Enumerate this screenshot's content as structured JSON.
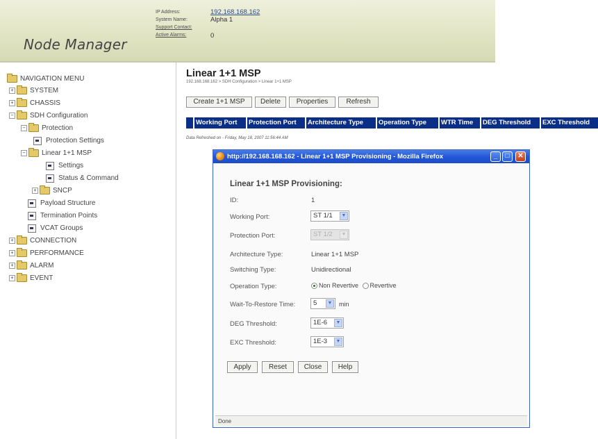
{
  "header": {
    "app_title": "Node Manager",
    "labels": {
      "ip_address": "IP Address:",
      "system_name": "System Name:",
      "support_contact": "Support Contact:",
      "active_alarms": "Active Alarms:"
    },
    "values": {
      "ip_address": "192.168.168.162",
      "system_name": "Alpha 1",
      "active_alarms": "0"
    }
  },
  "nav": {
    "title": "NAVIGATION MENU",
    "system": "SYSTEM",
    "chassis": "CHASSIS",
    "sdh_configuration": "SDH Configuration",
    "protection": "Protection",
    "protection_settings": "Protection Settings",
    "linear_msp": "Linear 1+1 MSP",
    "settings": "Settings",
    "status_command": "Status & Command",
    "sncp": "SNCP",
    "payload_structure": "Payload Structure",
    "termination_points": "Termination Points",
    "vcat_groups": "VCAT Groups",
    "connection": "CONNECTION",
    "performance": "PERFORMANCE",
    "alarm": "ALARM",
    "event": "EVENT"
  },
  "main": {
    "title": "Linear 1+1 MSP",
    "breadcrumb": "192.168.168.162 > SDH Configuration > Linear 1+1 MSP",
    "buttons": {
      "create": "Create 1+1 MSP",
      "delete": "Delete",
      "properties": "Properties",
      "refresh": "Refresh"
    },
    "table_headers": [
      "Working Port",
      "Protection Port",
      "Architecture Type",
      "Operation Type",
      "WTR Time",
      "DEG Threshold",
      "EXC Threshold"
    ],
    "refreshed": "Data Refreshed on - Friday, May 18, 2007 11:56:44 AM"
  },
  "popup": {
    "window_title": "http://192.168.168.162 - Linear 1+1 MSP Provisioning - Mozilla Firefox",
    "form_title": "Linear 1+1 MSP Provisioning:",
    "labels": {
      "id": "ID:",
      "working_port": "Working Port:",
      "protection_port": "Protection Port:",
      "architecture_type": "Architecture Type:",
      "switching_type": "Switching Type:",
      "operation_type": "Operation Type:",
      "wait_to_restore": "Wait-To-Restore Time:",
      "deg_threshold": "DEG Threshold:",
      "exc_threshold": "EXC Threshold:"
    },
    "values": {
      "id": "1",
      "working_port": "ST 1/1",
      "protection_port": "ST 1/2",
      "architecture_type": "Linear 1+1 MSP",
      "switching_type": "Unidirectional",
      "operation_non_revertive": "Non Revertive",
      "operation_revertive": "Revertive",
      "wtr_value": "5",
      "wtr_unit": "min",
      "deg_threshold": "1E-6",
      "exc_threshold": "1E-3"
    },
    "buttons": {
      "apply": "Apply",
      "reset": "Reset",
      "close": "Close",
      "help": "Help"
    },
    "status": "Done"
  }
}
